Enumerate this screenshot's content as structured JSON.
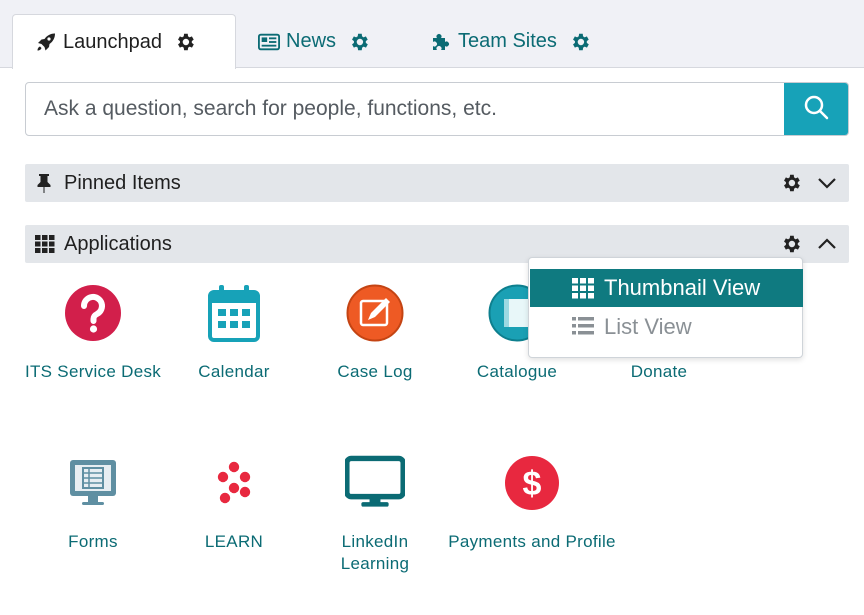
{
  "tabs": [
    {
      "label": "Launchpad",
      "icon": "rocket-icon",
      "active": true
    },
    {
      "label": "News",
      "icon": "newspaper-icon",
      "active": false
    },
    {
      "label": "Team Sites",
      "icon": "puzzle-icon",
      "active": false
    }
  ],
  "search": {
    "placeholder": "Ask a question, search for people, functions, etc."
  },
  "sections": {
    "pinned": {
      "label": "Pinned Items",
      "icon": "pushpin-icon",
      "expanded": false
    },
    "applications": {
      "label": "Applications",
      "icon": "grid-icon",
      "expanded": true
    }
  },
  "applications": [
    {
      "label": "ITS Service Desk",
      "icon": "question-circle-icon"
    },
    {
      "label": "Calendar",
      "icon": "calendar-icon"
    },
    {
      "label": "Case Log",
      "icon": "pencil-square-icon"
    },
    {
      "label": "Catalogue",
      "icon": "book-icon"
    },
    {
      "label": "Donate",
      "icon": "donate-icon"
    },
    {
      "label": "Forms",
      "icon": "monitor-form-icon"
    },
    {
      "label": "LEARN",
      "icon": "learn-dots-icon"
    },
    {
      "label": "LinkedIn Learning",
      "icon": "monitor-icon"
    },
    {
      "label": "Payments and Profile",
      "icon": "dollar-circle-icon"
    }
  ],
  "view_menu": {
    "items": [
      {
        "label": "Thumbnail View",
        "icon": "grid-icon",
        "selected": true
      },
      {
        "label": "List View",
        "icon": "list-icon",
        "selected": false
      }
    ]
  },
  "colors": {
    "accent": "#0b6b74",
    "search_button": "#17a2b8",
    "selected_item": "#0f7a80",
    "section_bar": "#e3e6ea"
  }
}
